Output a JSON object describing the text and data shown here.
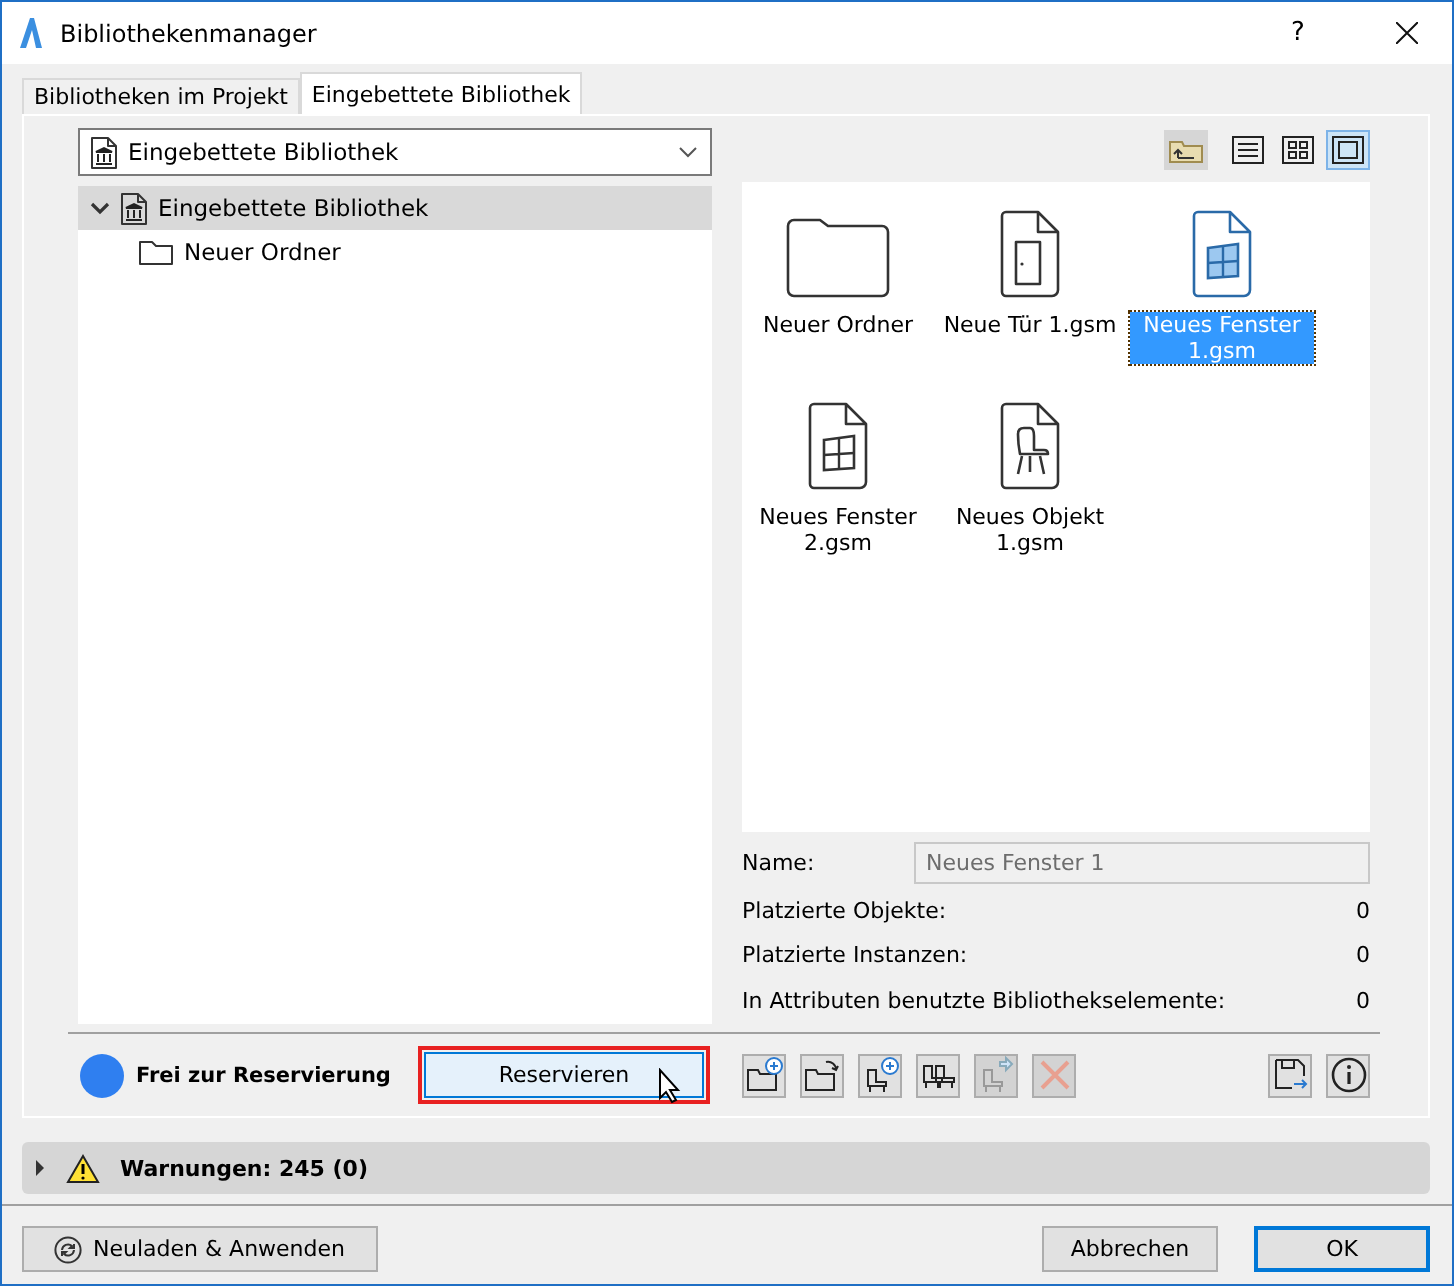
{
  "window": {
    "title": "Bibliothekenmanager",
    "help": "?"
  },
  "tabs": [
    {
      "label": "Bibliotheken im Projekt",
      "selected": false
    },
    {
      "label": "Eingebettete Bibliothek",
      "selected": true
    }
  ],
  "library_dropdown": {
    "value": "Eingebettete Bibliothek"
  },
  "tree": [
    {
      "label": "Eingebettete Bibliothek",
      "kind": "library",
      "expanded": true,
      "selected": true,
      "children": [
        {
          "label": "Neuer Ordner",
          "kind": "folder",
          "selected": false
        }
      ]
    }
  ],
  "view_buttons": [
    {
      "kind": "up",
      "selected": false
    },
    {
      "kind": "list",
      "selected": false
    },
    {
      "kind": "grid",
      "selected": false
    },
    {
      "kind": "large",
      "selected": true
    }
  ],
  "items": [
    {
      "label": "Neuer Ordner",
      "kind": "folder",
      "selected": false
    },
    {
      "label": "Neue Tür 1.gsm",
      "kind": "door",
      "selected": false
    },
    {
      "label": "Neues Fenster 1.gsm",
      "kind": "window",
      "selected": true
    },
    {
      "label": "Neues Fenster 2.gsm",
      "kind": "window",
      "selected": false
    },
    {
      "label": "Neues Objekt 1.gsm",
      "kind": "object",
      "selected": false
    }
  ],
  "name_field": {
    "label": "Name:",
    "value": "Neues Fenster 1"
  },
  "stats": [
    {
      "label": "Platzierte Objekte:",
      "value": "0"
    },
    {
      "label": "Platzierte Instanzen:",
      "value": "0"
    },
    {
      "label": "In Attributen benutzte Bibliothekselemente:",
      "value": "0"
    }
  ],
  "reservation": {
    "status": "Frei zur Reservierung",
    "color": "#2f7ff0",
    "button": "Reservieren"
  },
  "tool_buttons": [
    {
      "kind": "new-folder",
      "disabled": false
    },
    {
      "kind": "open-folder",
      "disabled": false
    },
    {
      "kind": "add-object",
      "disabled": false
    },
    {
      "kind": "objects",
      "disabled": false
    },
    {
      "kind": "export",
      "disabled": true
    },
    {
      "kind": "delete",
      "disabled": true
    }
  ],
  "side_buttons": [
    {
      "kind": "save"
    },
    {
      "kind": "info"
    }
  ],
  "warnings": {
    "label": "Warnungen: 245 (0)",
    "expanded": false
  },
  "footer": {
    "reload": "Neuladen & Anwenden",
    "cancel": "Abbrechen",
    "ok": "OK"
  }
}
